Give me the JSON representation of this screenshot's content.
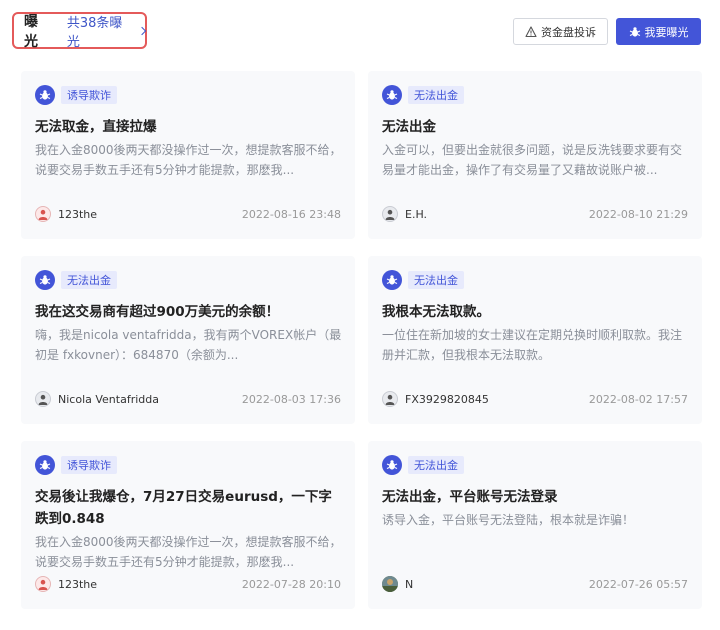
{
  "header": {
    "title": "曝光",
    "count_label": "共38条曝光",
    "complaint_button": "资金盘投诉",
    "expose_button": "我要曝光"
  },
  "colors": {
    "accent": "#4355d8",
    "highlight_border": "#e45a5a",
    "badge_bg": "#e7eafc"
  },
  "cards": [
    {
      "badge": "诱导欺诈",
      "title": "无法取金，直接拉爆",
      "desc": "我在入金8000後两天都没操作过一次，想提款客服不给，说要交易手数五手还有5分钟才能提款，那麽我...",
      "user": "123the",
      "avatar": "red",
      "date": "2022-08-16 23:48"
    },
    {
      "badge": "无法出金",
      "title": "无法出金",
      "desc": "入金可以，但要出金就很多问题，说是反洗钱要求要有交易量才能出金，操作了有交易量了又藉故说账户被...",
      "user": "E.H.",
      "avatar": "gray",
      "date": "2022-08-10 21:29"
    },
    {
      "badge": "无法出金",
      "title": "我在这交易商有超过900万美元的余额！",
      "desc": "嗨，我是nicola ventafridda，我有两个VOREX帐户（最初是 fxkovner）：684870（余额为...",
      "user": "Nicola Ventafridda",
      "avatar": "gray",
      "date": "2022-08-03 17:36"
    },
    {
      "badge": "无法出金",
      "title": "我根本无法取款。",
      "desc": "一位住在新加坡的女士建议在定期兑换时顺利取款。我注册并汇款，但我根本无法取款。",
      "user": "FX3929820845",
      "avatar": "gray",
      "date": "2022-08-02 17:57"
    },
    {
      "badge": "诱导欺诈",
      "title": "交易後让我爆仓，7月27日交易eurusd，一下字跌到0.848",
      "desc": "我在入金8000後两天都没操作过一次，想提款客服不给，说要交易手数五手还有5分钟才能提款，那麽我...",
      "user": "123the",
      "avatar": "red",
      "date": "2022-07-28 20:10"
    },
    {
      "badge": "无法出金",
      "title": "无法出金，平台账号无法登录",
      "desc": "诱导入金，平台账号无法登陆，根本就是诈骗！",
      "user": "N",
      "avatar": "photo",
      "date": "2022-07-26 05:57"
    }
  ]
}
